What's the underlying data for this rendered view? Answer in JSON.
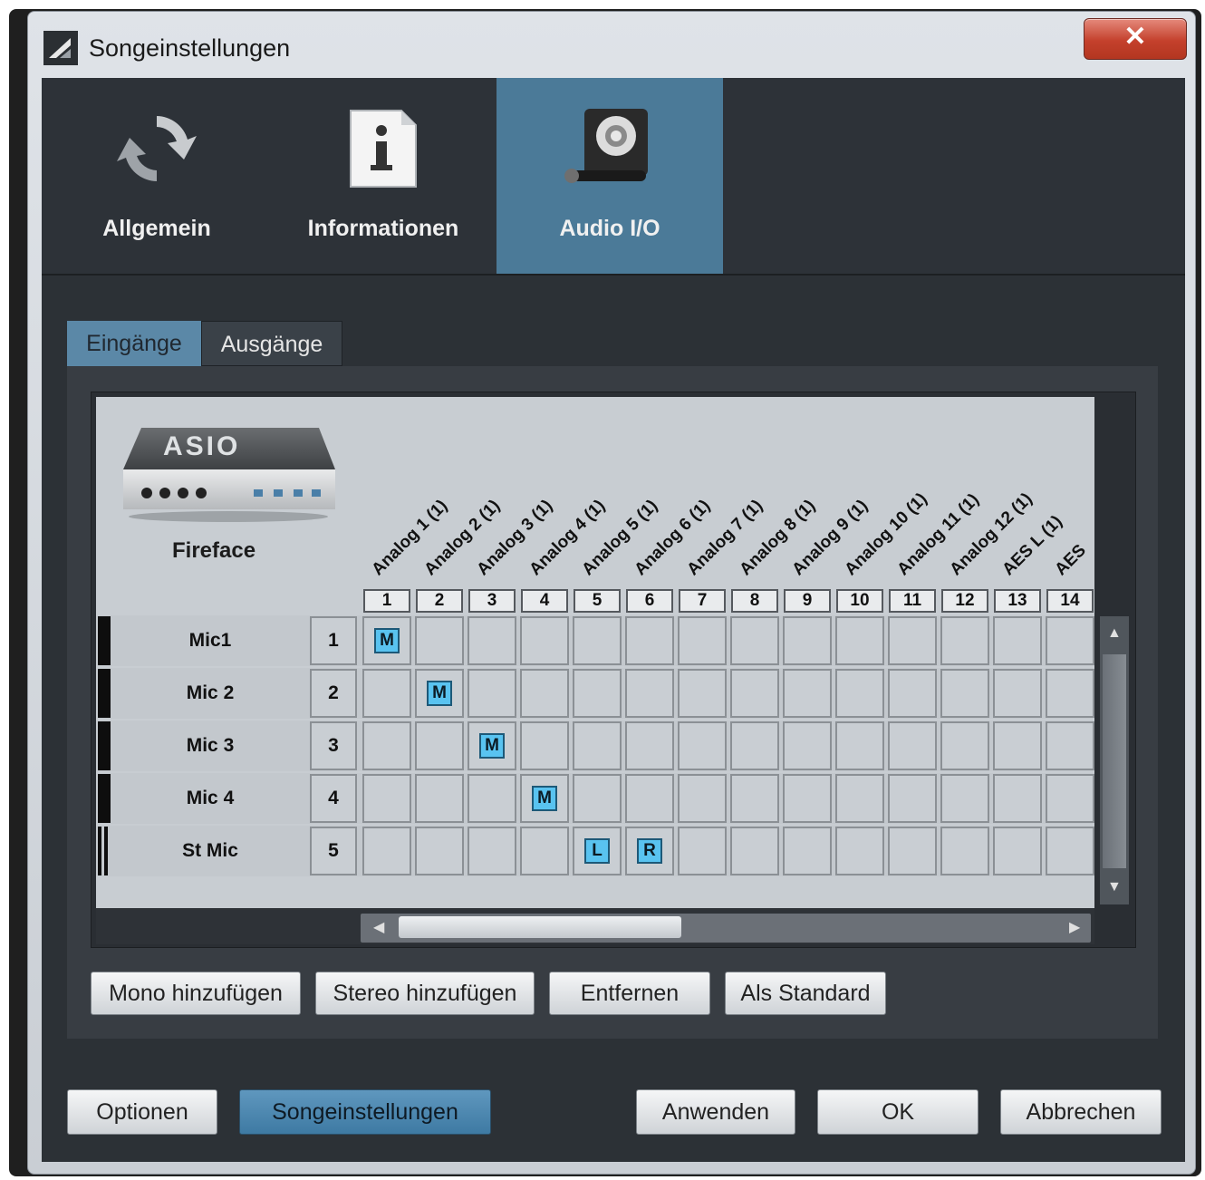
{
  "window": {
    "title": "Songeinstellungen",
    "close_label": "✕"
  },
  "main_tabs": [
    {
      "label": "Allgemein",
      "icon": "refresh-icon",
      "selected": false
    },
    {
      "label": "Informationen",
      "icon": "info-document-icon",
      "selected": false
    },
    {
      "label": "Audio I/O",
      "icon": "speaker-microphone-icon",
      "selected": true
    }
  ],
  "sub_tabs": [
    {
      "label": "Eingänge",
      "selected": true
    },
    {
      "label": "Ausgänge",
      "selected": false
    }
  ],
  "device": {
    "badge": "ASIO",
    "name": "Fireface"
  },
  "channels": [
    "Analog 1 (1)",
    "Analog 2 (1)",
    "Analog 3 (1)",
    "Analog 4 (1)",
    "Analog 5 (1)",
    "Analog 6 (1)",
    "Analog 7 (1)",
    "Analog 8 (1)",
    "Analog 9 (1)",
    "Analog 10 (1)",
    "Analog 11 (1)",
    "Analog 12 (1)",
    "AES L (1)",
    "AES"
  ],
  "column_numbers": [
    "1",
    "2",
    "3",
    "4",
    "5",
    "6",
    "7",
    "8",
    "9",
    "10",
    "11",
    "12",
    "13",
    "14"
  ],
  "rows": [
    {
      "name": "Mic1",
      "num": "1",
      "type": "mono",
      "assign": [
        {
          "col": 1,
          "mark": "M"
        }
      ]
    },
    {
      "name": "Mic 2",
      "num": "2",
      "type": "mono",
      "assign": [
        {
          "col": 2,
          "mark": "M"
        }
      ]
    },
    {
      "name": "Mic 3",
      "num": "3",
      "type": "mono",
      "assign": [
        {
          "col": 3,
          "mark": "M"
        }
      ]
    },
    {
      "name": "Mic 4",
      "num": "4",
      "type": "mono",
      "assign": [
        {
          "col": 4,
          "mark": "M"
        }
      ]
    },
    {
      "name": "St Mic",
      "num": "5",
      "type": "stereo",
      "assign": [
        {
          "col": 5,
          "mark": "L"
        },
        {
          "col": 6,
          "mark": "R"
        }
      ]
    }
  ],
  "panel_buttons": {
    "mono": "Mono hinzufügen",
    "stereo": "Stereo hinzufügen",
    "remove": "Entfernen",
    "default": "Als Standard"
  },
  "footer_buttons": {
    "options": "Optionen",
    "song_settings": "Songeinstellungen",
    "apply": "Anwenden",
    "ok": "OK",
    "cancel": "Abbrechen"
  },
  "colors": {
    "selected_tab": "#4b7a98",
    "mark": "#59c3f0",
    "accent_button": "#4f88b0"
  }
}
